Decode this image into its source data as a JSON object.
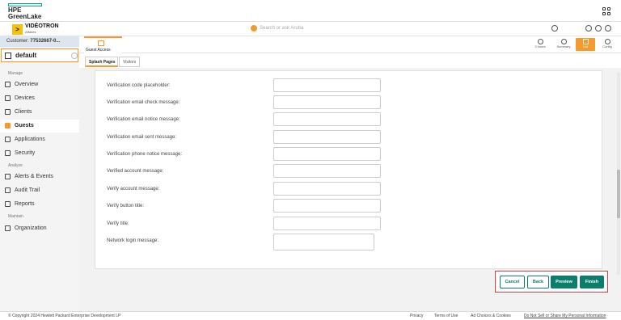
{
  "brand": {
    "logo_line1": "HPE",
    "logo_line2": "GreenLake",
    "brand_color": "#01a982",
    "accent_color": "#f59b2d",
    "button_color": "#0a7e6a"
  },
  "account": {
    "badge": ">",
    "name": "VIDÉOTRON",
    "sub": "Affaires"
  },
  "search": {
    "placeholder": "Search or ask Aruba"
  },
  "top_icons": [
    "search-icon",
    "bell-icon",
    "help-icon",
    "user-icon"
  ],
  "sidebar": {
    "customer_label": "Customer:",
    "customer_value": "77532667-0...",
    "group": "default",
    "sections": [
      {
        "label": "Manage",
        "items": [
          {
            "label": "Overview",
            "icon": "overview-icon"
          },
          {
            "label": "Devices",
            "icon": "devices-icon"
          },
          {
            "label": "Clients",
            "icon": "clients-icon"
          },
          {
            "label": "Guests",
            "icon": "guests-icon",
            "active": true
          },
          {
            "label": "Applications",
            "icon": "applications-icon"
          },
          {
            "label": "Security",
            "icon": "security-icon"
          }
        ]
      },
      {
        "label": "Analyze",
        "items": [
          {
            "label": "Alerts & Events",
            "icon": "alert-icon"
          },
          {
            "label": "Audit Trail",
            "icon": "audit-icon"
          },
          {
            "label": "Reports",
            "icon": "reports-icon"
          }
        ]
      },
      {
        "label": "Maintain",
        "items": [
          {
            "label": "Organization",
            "icon": "organization-icon"
          }
        ]
      }
    ]
  },
  "header": {
    "active_tab": "Guest Access",
    "buttons": [
      {
        "label": "3 hours",
        "icon": "clock-icon"
      },
      {
        "label": "Summary",
        "icon": "summary-icon"
      },
      {
        "label": "List",
        "icon": "list-icon",
        "active": true
      },
      {
        "label": "Config",
        "icon": "gear-icon"
      }
    ]
  },
  "subtabs": [
    {
      "label": "Splash Pages",
      "active": true
    },
    {
      "label": "Visitors",
      "active": false
    }
  ],
  "form_rows": [
    {
      "label": "Verification code placeholder:",
      "value": ""
    },
    {
      "label": "Verification email check message:",
      "value": ""
    },
    {
      "label": "Verification email notice message:",
      "value": ""
    },
    {
      "label": "Verification email sent message:",
      "value": ""
    },
    {
      "label": "Verification phone notice message:",
      "value": ""
    },
    {
      "label": "Verified account message:",
      "value": ""
    },
    {
      "label": "Verify account message:",
      "value": ""
    },
    {
      "label": "Verify button title:",
      "value": ""
    },
    {
      "label": "Verify title:",
      "value": ""
    },
    {
      "label": "Network login message:",
      "value": ""
    }
  ],
  "actions": {
    "cancel": "Cancel",
    "back": "Back",
    "preview": "Preview",
    "finish": "Finish"
  },
  "footer": {
    "copyright": "© Copyright 2024 Hewlett Packard Enterprise Development LP",
    "links": [
      "Privacy",
      "Terms of Use",
      "Ad Choices & Cookies",
      "Do Not Sell or Share My Personal Information"
    ]
  }
}
